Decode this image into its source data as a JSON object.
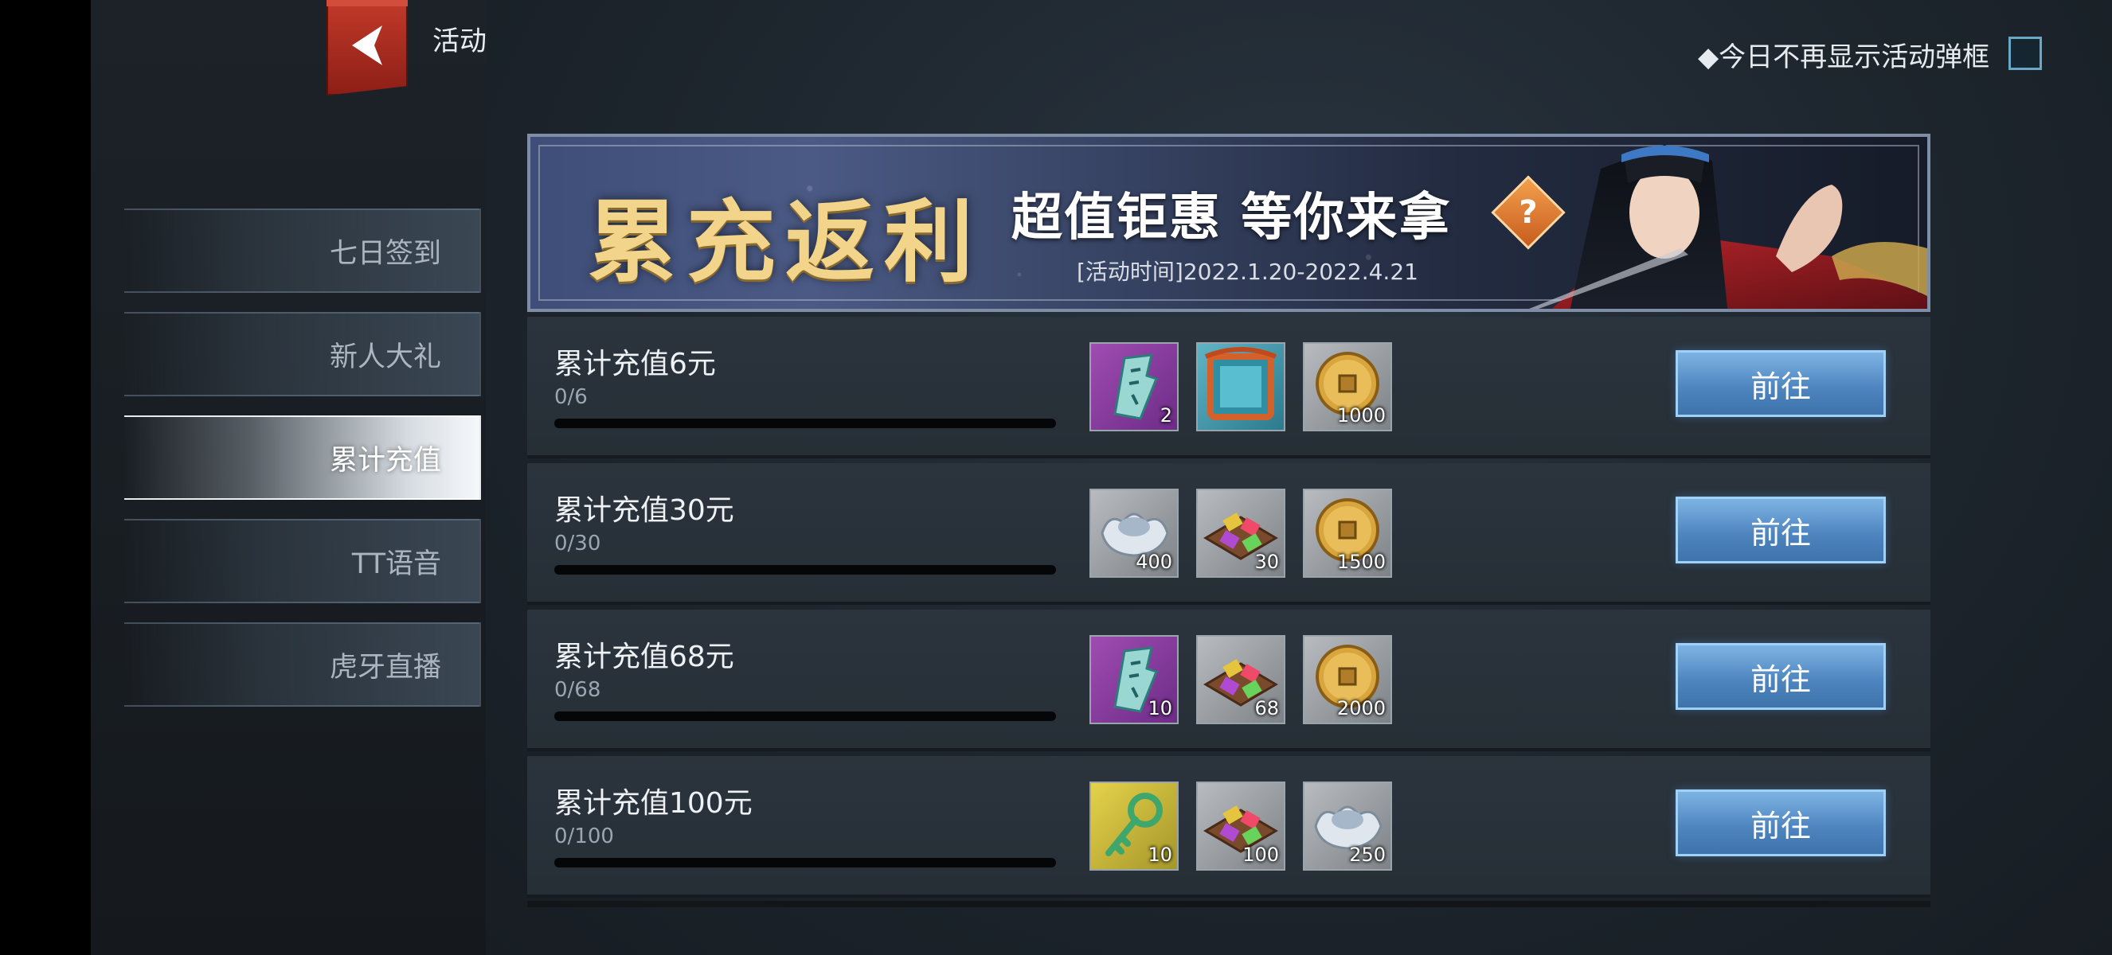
{
  "header": {
    "title": "活动",
    "dont_show_today": "◆今日不再显示活动弹框"
  },
  "sidebar": {
    "items": [
      {
        "label": "七日签到"
      },
      {
        "label": "新人大礼"
      },
      {
        "label": "累计充值"
      },
      {
        "label": "TT语音"
      },
      {
        "label": "虎牙直播"
      }
    ],
    "active_index": 2
  },
  "banner": {
    "title": "累充返利",
    "slogan": "超值钜惠 等你来拿",
    "help_symbol": "?",
    "time": "[活动时间]2022.1.20-2022.4.21"
  },
  "rewards": [
    {
      "label": "累计充值6元",
      "progress_text": "0/6",
      "progress": 0,
      "button_label": "前往",
      "items": [
        {
          "icon": "jade-token-icon",
          "bg": "purple",
          "qty": "2"
        },
        {
          "icon": "avatar-frame-icon",
          "bg": "teal",
          "qty": ""
        },
        {
          "icon": "copper-coin-icon",
          "bg": "gray",
          "qty": "1000"
        }
      ]
    },
    {
      "label": "累计充值30元",
      "progress_text": "0/30",
      "progress": 0,
      "button_label": "前往",
      "items": [
        {
          "icon": "silver-ingot-icon",
          "bg": "gray",
          "qty": "400"
        },
        {
          "icon": "gem-box-icon",
          "bg": "gray",
          "qty": "30"
        },
        {
          "icon": "copper-coin-icon",
          "bg": "gray",
          "qty": "1500"
        }
      ]
    },
    {
      "label": "累计充值68元",
      "progress_text": "0/68",
      "progress": 0,
      "button_label": "前往",
      "items": [
        {
          "icon": "jade-token-icon",
          "bg": "purple",
          "qty": "10"
        },
        {
          "icon": "gem-box-icon",
          "bg": "gray",
          "qty": "68"
        },
        {
          "icon": "copper-coin-icon",
          "bg": "gray",
          "qty": "2000"
        }
      ]
    },
    {
      "label": "累计充值100元",
      "progress_text": "0/100",
      "progress": 0,
      "button_label": "前往",
      "items": [
        {
          "icon": "jade-key-icon",
          "bg": "gold",
          "qty": "10"
        },
        {
          "icon": "gem-box-icon",
          "bg": "gray",
          "qty": "100"
        },
        {
          "icon": "silver-ingot-icon",
          "bg": "gray",
          "qty": "250"
        }
      ]
    }
  ]
}
